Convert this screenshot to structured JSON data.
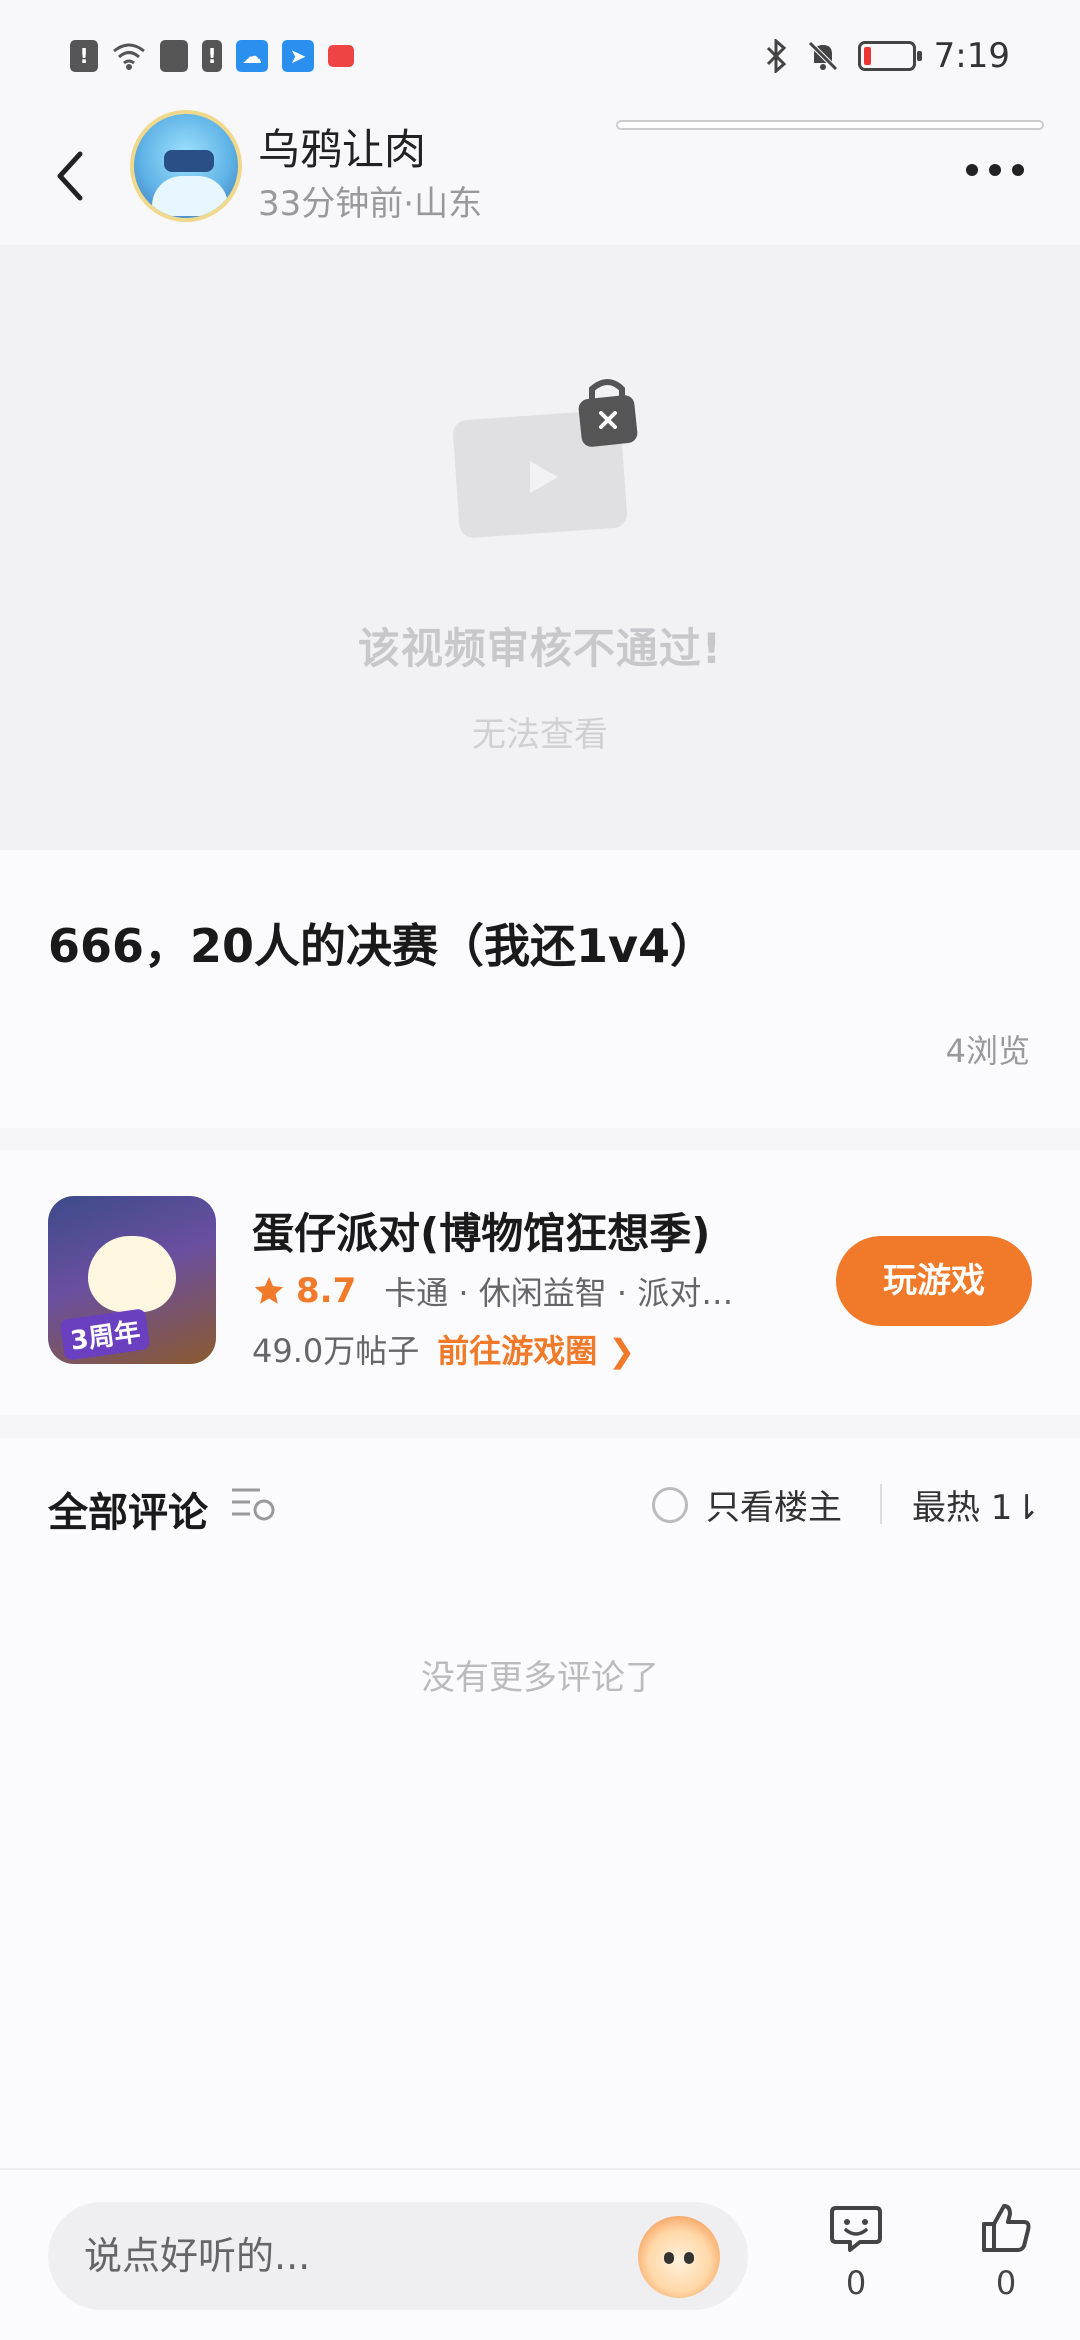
{
  "status_bar": {
    "time": "7:19",
    "left_icons": [
      "alert-icon",
      "wifi-icon",
      "mail-icon",
      "alert-icon",
      "weather-icon",
      "app-icon",
      "book-icon"
    ],
    "wifi_tag": "6",
    "right_icons": [
      "bluetooth-icon",
      "mute-bell-icon",
      "battery-icon"
    ],
    "battery_color": "#e33333"
  },
  "header": {
    "username": "乌鸦让肉",
    "meta": "33分钟前·山东"
  },
  "video": {
    "error_title": "该视频审核不通过!",
    "error_sub": "无法查看"
  },
  "post": {
    "title": "666，20人的决赛（我还1v4）",
    "views": "4浏览"
  },
  "game": {
    "name": "蛋仔派对(博物馆狂想季)",
    "badge": "3周年",
    "rating": "8.7",
    "tags": "卡通 · 休闲益智 · 派对…",
    "post_count": "49.0万帖子",
    "goto_label": "前往游戏圈 ❯",
    "play_label": "玩游戏",
    "accent_color": "#f07a2a"
  },
  "comments": {
    "title": "全部评论",
    "only_owner_label": "只看楼主",
    "sort_label": "最热 1⇂",
    "empty_text": "没有更多评论了"
  },
  "bottom_bar": {
    "input_placeholder": "说点好听的...",
    "comment_count": "0",
    "like_count": "0"
  }
}
